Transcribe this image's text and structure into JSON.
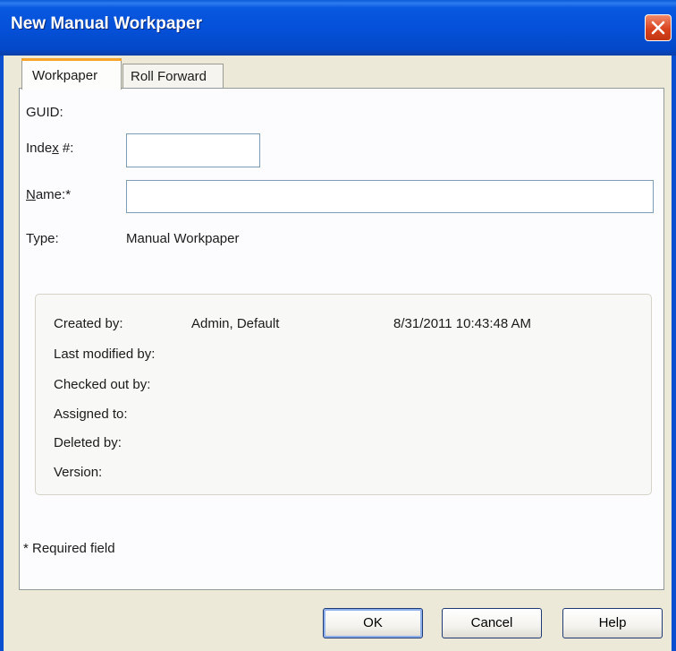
{
  "window": {
    "title": "New Manual Workpaper",
    "close_icon": "close-icon",
    "colors": {
      "titlebar": "#0551d9",
      "close": "#d9431e",
      "face": "#ece9d8",
      "tab_accent": "#f7a42a"
    }
  },
  "tabs": [
    {
      "label": "Workpaper",
      "active": true
    },
    {
      "label": "Roll Forward",
      "active": false
    }
  ],
  "form": {
    "guid_label": "GUID:",
    "index_label_pre": "Inde",
    "index_label_accel": "x",
    "index_label_post": " #:",
    "index_value": "",
    "name_label_pre": "",
    "name_label_accel": "N",
    "name_label_post": "ame:*",
    "name_value": "",
    "type_label": "Type:",
    "type_value": "Manual Workpaper"
  },
  "info": {
    "created_by_label": "Created by:",
    "created_by_value": "Admin, Default",
    "created_date": "8/31/2011 10:43:48 AM",
    "last_modified_label": "Last modified by:",
    "checked_out_label": "Checked out by:",
    "assigned_to_label": "Assigned to:",
    "deleted_by_label": "Deleted by:",
    "version_label": "Version:"
  },
  "required_note": "* Required field",
  "buttons": {
    "ok": "OK",
    "cancel": "Cancel",
    "help": "Help"
  }
}
